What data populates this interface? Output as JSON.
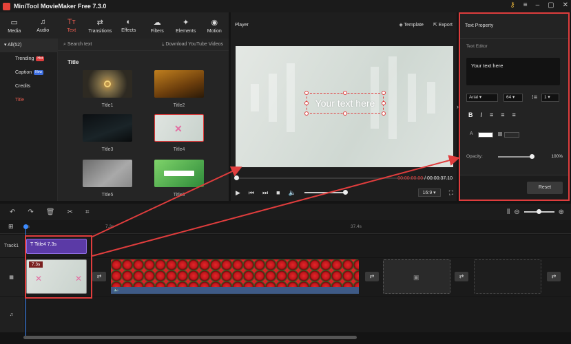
{
  "app": {
    "title": "MiniTool MovieMaker Free 7.3.0"
  },
  "toolbar": {
    "items": [
      {
        "label": "Media",
        "icon": "folder-icon",
        "glyph": "▭"
      },
      {
        "label": "Audio",
        "icon": "music-icon",
        "glyph": "♫"
      },
      {
        "label": "Text",
        "icon": "text-icon",
        "glyph": "Tт"
      },
      {
        "label": "Transitions",
        "icon": "transitions-icon",
        "glyph": "⇄"
      },
      {
        "label": "Effects",
        "icon": "effects-icon",
        "glyph": "◐"
      },
      {
        "label": "Filters",
        "icon": "filters-icon",
        "glyph": "☁"
      },
      {
        "label": "Elements",
        "icon": "elements-icon",
        "glyph": "✦"
      },
      {
        "label": "Motion",
        "icon": "motion-icon",
        "glyph": "◉"
      }
    ],
    "active": "Text"
  },
  "categories": {
    "all": "All(52)",
    "items": [
      {
        "label": "Trending",
        "badge": "Hot"
      },
      {
        "label": "Caption",
        "badge": "New"
      },
      {
        "label": "Credits",
        "badge": ""
      },
      {
        "label": "Title",
        "badge": ""
      }
    ],
    "selected": "Title"
  },
  "library": {
    "search_placeholder": "Search text",
    "download_label": "Download YouTube Videos",
    "section_title": "Title",
    "thumbs": [
      "Title1",
      "Title2",
      "Title3",
      "Title4",
      "Title5",
      "Title6"
    ]
  },
  "player": {
    "label": "Player",
    "template_label": "Template",
    "export_label": "Export",
    "overlay_text": "Your text here",
    "current_time": "00:00:00.00",
    "total_time": "/ 00:00:37.10",
    "aspect": "16:9"
  },
  "property": {
    "title": "Text Property",
    "editor_label": "Text Editor",
    "editor_text": "Your text here",
    "font": "Arial",
    "size": "64",
    "line_spacing": "1",
    "opacity_label": "Opacity:",
    "opacity_value": "100%",
    "reset_label": "Reset"
  },
  "timeline": {
    "ticks": [
      "0s",
      "7.3s",
      "37.4s"
    ],
    "track1_label": "Track1",
    "text_clip": {
      "name": "Title4",
      "duration": "7.3s"
    },
    "video_clip_duration": "7.3s"
  },
  "colors": {
    "accent": "#e85c4f",
    "highlight": "#e03d3d",
    "text_clip": "#5b3aa6"
  }
}
